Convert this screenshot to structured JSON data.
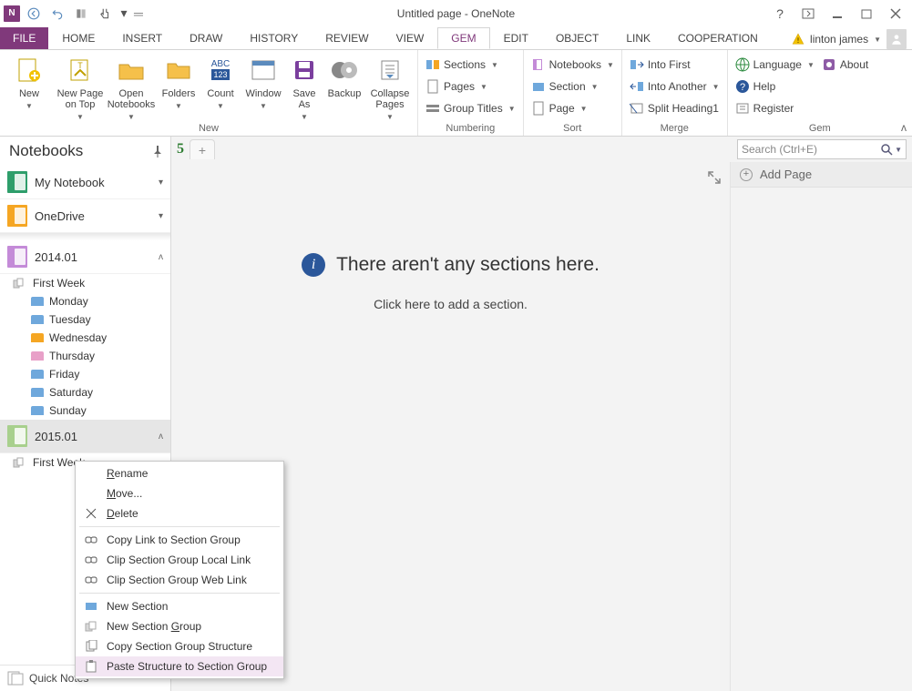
{
  "title": "Untitled page - OneNote",
  "user": {
    "name": "linton james"
  },
  "search": {
    "placeholder": "Search (Ctrl+E)"
  },
  "tabs": {
    "file": "FILE",
    "items": [
      "HOME",
      "INSERT",
      "DRAW",
      "HISTORY",
      "REVIEW",
      "VIEW",
      "GEM",
      "EDIT",
      "OBJECT",
      "LINK",
      "COOPERATION"
    ],
    "active": "GEM"
  },
  "ribbon": {
    "groups": {
      "new": {
        "label": "New",
        "new": "New",
        "new_page_on_top": "New Page\non Top",
        "open_notebooks": "Open\nNotebooks",
        "folders": "Folders",
        "count": "Count",
        "window": "Window",
        "save_as": "Save\nAs",
        "backup": "Backup",
        "collapse_pages": "Collapse\nPages"
      },
      "numbering": {
        "label": "Numbering",
        "sections": "Sections",
        "pages": "Pages",
        "group_titles": "Group Titles"
      },
      "sort": {
        "label": "Sort",
        "notebooks": "Notebooks",
        "section": "Section",
        "page": "Page"
      },
      "merge": {
        "label": "Merge",
        "into_first": "Into First",
        "into_another": "Into Another",
        "split_heading1": "Split Heading1"
      },
      "gem": {
        "label": "Gem",
        "language": "Language",
        "about": "About",
        "help": "Help",
        "register": "Register"
      }
    }
  },
  "nav": {
    "title": "Notebooks",
    "notebooks": [
      {
        "name": "My Notebook",
        "color": "#2e9e6b",
        "chev": "▾"
      },
      {
        "name": "OneDrive",
        "color": "#f5a623",
        "chev": "▾"
      }
    ],
    "section_groups": [
      {
        "name": "2014.01",
        "color": "#c48bd8",
        "expanded": true,
        "selected": false,
        "group_name": "First Week",
        "days": [
          {
            "name": "Monday",
            "color": "#6fa8dc"
          },
          {
            "name": "Tuesday",
            "color": "#6fa8dc"
          },
          {
            "name": "Wednesday",
            "color": "#f5a623"
          },
          {
            "name": "Thursday",
            "color": "#e8a0c8"
          },
          {
            "name": "Friday",
            "color": "#6fa8dc"
          },
          {
            "name": "Saturday",
            "color": "#6fa8dc"
          },
          {
            "name": "Sunday",
            "color": "#6fa8dc"
          }
        ]
      },
      {
        "name": "2015.01",
        "color": "#a8d08d",
        "expanded": true,
        "selected": true,
        "group_name": "First Week",
        "days": []
      }
    ],
    "quick_notes": "Quick Notes"
  },
  "empty_state": {
    "heading": "There aren't any sections here.",
    "sub": "Click here to add a section."
  },
  "pages_pane": {
    "add_page": "Add Page"
  },
  "context_menu": {
    "items": [
      {
        "type": "item",
        "label": "Rename",
        "u": 0,
        "icon": ""
      },
      {
        "type": "item",
        "label": "Move...",
        "u": 0,
        "icon": ""
      },
      {
        "type": "item",
        "label": "Delete",
        "u": 0,
        "icon": "x"
      },
      {
        "type": "sep"
      },
      {
        "type": "item",
        "label": "Copy Link to Section Group",
        "icon": "link"
      },
      {
        "type": "item",
        "label": "Clip Section Group Local Link",
        "icon": "link"
      },
      {
        "type": "item",
        "label": "Clip Section Group Web Link",
        "icon": "link"
      },
      {
        "type": "sep"
      },
      {
        "type": "item",
        "label": "New Section",
        "icon": "sec"
      },
      {
        "type": "item",
        "label": "New Section Group",
        "u": 12,
        "icon": "grp"
      },
      {
        "type": "item",
        "label": "Copy Section Group Structure",
        "icon": "copy"
      },
      {
        "type": "item",
        "label": "Paste Structure to Section Group",
        "icon": "paste",
        "hover": true
      }
    ]
  }
}
